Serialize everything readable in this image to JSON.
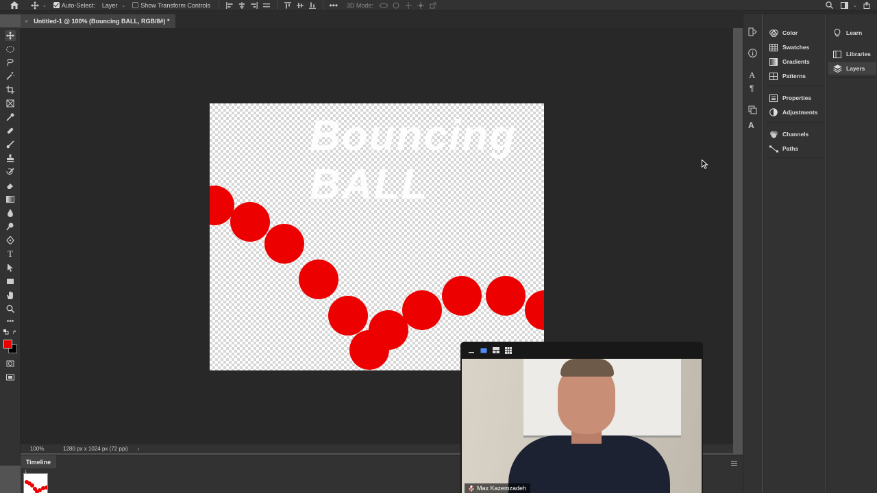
{
  "options_bar": {
    "auto_select_label": "Auto-Select:",
    "auto_select_checked": true,
    "layer_dropdown": "Layer",
    "show_transform_label": "Show Transform Controls",
    "show_transform_checked": false,
    "three_d_mode_label": "3D Mode:"
  },
  "document": {
    "tab_title": "Untitled-1 @ 100% (Bouncing BALL, RGB/8#) *"
  },
  "canvas": {
    "title_line1": "Bouncing",
    "title_line2": "BALL",
    "ball_color": "#ec0000"
  },
  "status_bar": {
    "zoom": "100%",
    "doc_info": "1280 px x 1024 px (72 ppi)"
  },
  "timeline": {
    "tab_label": "Timeline",
    "frame_number": "1"
  },
  "colors": {
    "foreground": "#e80000",
    "background": "#000000"
  },
  "panels": {
    "column1": [
      {
        "label": "Color",
        "icon": "color-wheel-icon"
      },
      {
        "label": "Swatches",
        "icon": "swatches-grid-icon"
      },
      {
        "label": "Gradients",
        "icon": "gradient-icon"
      },
      {
        "label": "Patterns",
        "icon": "patterns-grid-icon"
      },
      {
        "label": "Properties",
        "icon": "properties-icon"
      },
      {
        "label": "Adjustments",
        "icon": "adjustments-icon"
      },
      {
        "label": "Channels",
        "icon": "channels-icon"
      },
      {
        "label": "Paths",
        "icon": "paths-icon"
      }
    ],
    "column2": [
      {
        "label": "Learn",
        "icon": "lightbulb-icon"
      },
      {
        "label": "Libraries",
        "icon": "libraries-icon"
      },
      {
        "label": "Layers",
        "icon": "layers-icon",
        "active": true
      }
    ]
  },
  "video_call": {
    "participant_name": "Max Kazemzadeh"
  }
}
